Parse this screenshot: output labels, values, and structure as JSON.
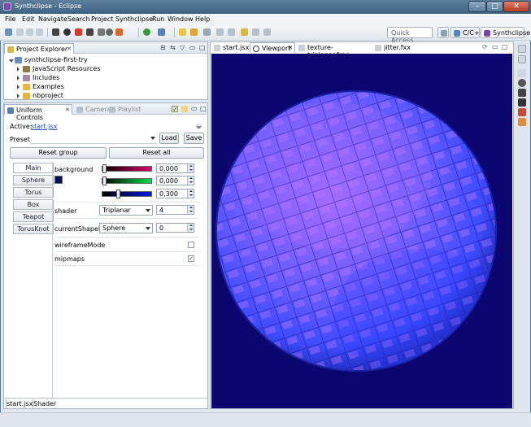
{
  "window": {
    "title": "Synthclipse - Eclipse",
    "minimize": "–",
    "maximize": "□",
    "close": "✕"
  },
  "menu": [
    "File",
    "Edit",
    "Navigate",
    "Search",
    "Project",
    "Synthclipse",
    "Run",
    "Window",
    "Help"
  ],
  "toolbar": {
    "quick_access_placeholder": "Quick Access",
    "perspective_cpp": "C/C++",
    "perspective_synthclipse": "Synthclipse"
  },
  "project_explorer": {
    "tab_label": "Project Explorer",
    "items": [
      {
        "label": "synthclipse-first-try",
        "level": 0,
        "open": true,
        "icon": "project-icon"
      },
      {
        "label": "JavaScript Resources",
        "level": 1,
        "open": false,
        "icon": "js-resources-icon"
      },
      {
        "label": "Includes",
        "level": 1,
        "open": false,
        "icon": "folder-icon"
      },
      {
        "label": "Examples",
        "level": 1,
        "open": false,
        "icon": "folder-icon"
      },
      {
        "label": "nbproject",
        "level": 1,
        "open": false,
        "icon": "folder-icon"
      }
    ]
  },
  "uniform_controls": {
    "tabs": [
      "Uniform Controls",
      "Camera",
      "Playlist"
    ],
    "active_label": "Active:",
    "active_file": "start.jsx",
    "preset_label": "Preset:",
    "preset_value": "",
    "load_label": "Load",
    "save_label": "Save",
    "reset_group_label": "Reset group",
    "reset_all_label": "Reset all",
    "groups": [
      "Main",
      "Sphere",
      "Torus",
      "Box",
      "Teapot",
      "TorusKnot"
    ],
    "background": {
      "label": "background",
      "r": "0,000",
      "g": "0,000",
      "b": "0,300",
      "b_level": 0.3,
      "swatch_color": "#0a0f5c"
    },
    "shader": {
      "label": "shader",
      "value": "Triplanar",
      "index": "4"
    },
    "current_shape": {
      "label": "currentShapeID",
      "value": "Sphere",
      "index": "0"
    },
    "wireframe": {
      "label": "wireframeMode",
      "checked": false
    },
    "mipmaps": {
      "label": "mipmaps",
      "checked": true,
      "check_glyph": "✓"
    },
    "bottom_tabs": [
      "start.jsx",
      "Shader"
    ]
  },
  "editor": {
    "tabs": [
      {
        "label": "start.jsx",
        "active": false
      },
      {
        "label": "Viewport",
        "active": true
      },
      {
        "label": "texture-triplanar.frag",
        "active": false
      },
      {
        "label": "jitter.fxx",
        "active": false
      }
    ]
  },
  "colors": {
    "viewport_bg": "#0c0670",
    "sphere_blue": "#4a6cff",
    "sphere_violet": "#b04cff",
    "accent_link": "#1a4fb5"
  }
}
